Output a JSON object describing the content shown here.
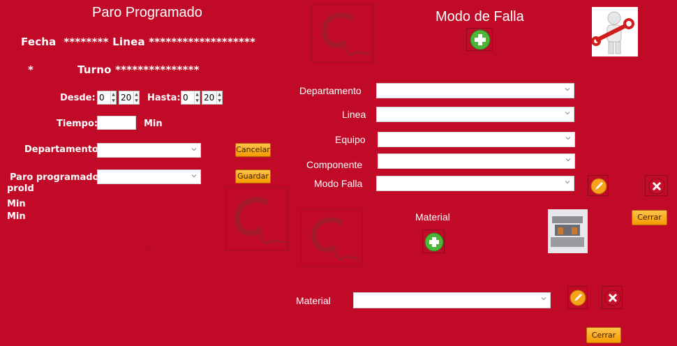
{
  "left": {
    "title": "Paro Programado",
    "fecha_line": "Fecha  ******** Linea *******************",
    "turno_star": "*",
    "turno_line": "Turno ***************",
    "desde_label": "Desde:",
    "desde_h": "0",
    "desde_m": "20",
    "hasta_label": "Hasta:",
    "hasta_h": "0",
    "hasta_m": "20",
    "tiempo_label": "Tiempo:",
    "tiempo_value": "",
    "min_label": "Min",
    "departamento_label": "Departamento:",
    "departamento_value": "",
    "paro_label": "Paro programado:",
    "paro_value": "",
    "cancelar_label": "Cancelar",
    "guardar_label": "Guardar",
    "proid_label": "proId",
    "min1": "Min",
    "min2": "Min",
    "dash": "-"
  },
  "right": {
    "title": "Modo de Falla",
    "departamento_label": "Departamento",
    "linea_label": "Linea",
    "equipo_label": "Equipo",
    "componente_label": "Componente",
    "modo_falla_label": "Modo Falla",
    "material_title": "Material",
    "cerrar1_label": "Cerrar",
    "material_label": "Material",
    "cerrar2_label": "Cerrar"
  },
  "icons": {
    "add": "plus-circle-icon",
    "edit": "pencil-icon",
    "delete": "x-circle-icon",
    "repair": "wrench-man-icon",
    "mold": "mold-machine-icon"
  },
  "colors": {
    "background": "#c10a27",
    "button": "#f5a623"
  }
}
